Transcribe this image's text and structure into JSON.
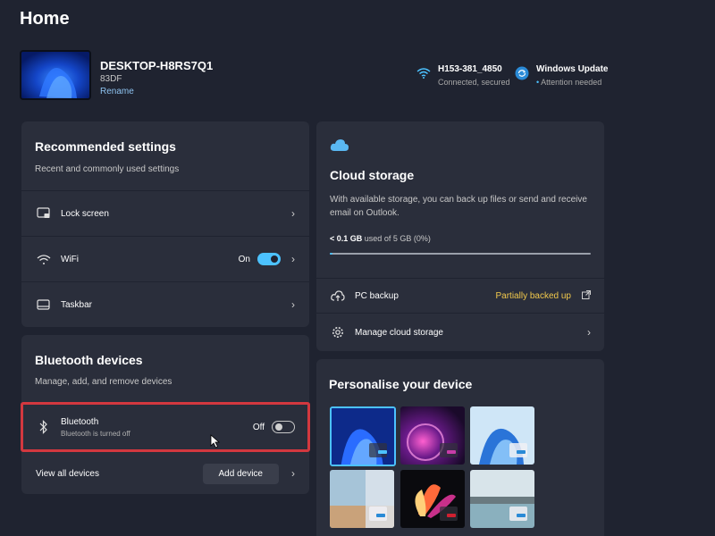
{
  "page": {
    "title": "Home"
  },
  "device": {
    "name": "DESKTOP-H8RS7Q1",
    "model": "83DF",
    "rename_label": "Rename"
  },
  "network": {
    "name": "H153-381_4850",
    "status": "Connected, secured"
  },
  "update": {
    "title": "Windows Update",
    "status": "Attention needed"
  },
  "recommended": {
    "title": "Recommended settings",
    "subtitle": "Recent and commonly used settings",
    "items": [
      {
        "label": "Lock screen",
        "icon": "lock-screen-icon"
      },
      {
        "label": "WiFi",
        "icon": "wifi-icon",
        "state": "On",
        "toggle_on": true
      },
      {
        "label": "Taskbar",
        "icon": "taskbar-icon"
      }
    ]
  },
  "bluetooth": {
    "title": "Bluetooth devices",
    "subtitle": "Manage, add, and remove devices",
    "item_label": "Bluetooth",
    "item_sub": "Bluetooth is turned off",
    "state": "Off",
    "toggle_on": false,
    "view_all_label": "View all devices",
    "add_device_label": "Add device"
  },
  "cloud": {
    "title": "Cloud storage",
    "description": "With available storage, you can back up files or send and receive email on Outlook.",
    "used_prefix": "< 0.1 GB",
    "used_suffix": "used of 5 GB (0%)",
    "used_fraction": 0.01,
    "backup_label": "PC backup",
    "backup_status": "Partially backed up",
    "manage_label": "Manage cloud storage"
  },
  "personalise": {
    "title": "Personalise your device"
  },
  "colors": {
    "accent": "#4cc2ff",
    "warning": "#f2c94c",
    "highlight": "#d3383f"
  }
}
